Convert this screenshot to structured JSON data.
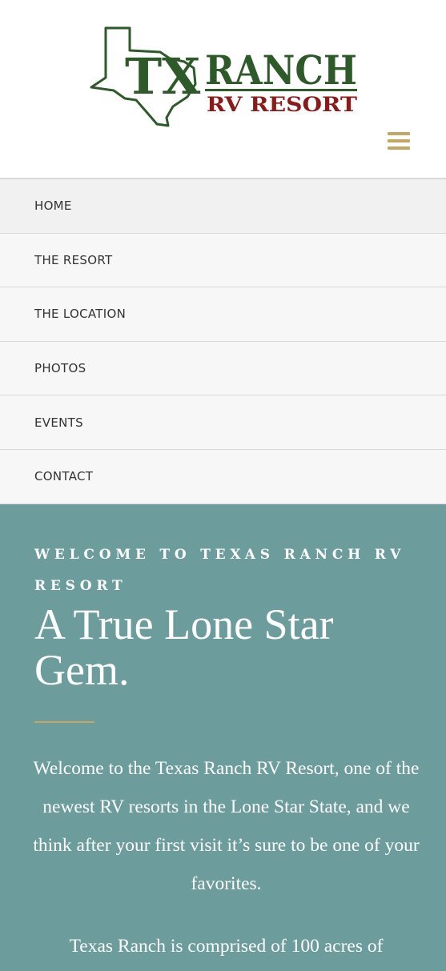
{
  "logo": {
    "mark": "TX",
    "name": "RANCH",
    "tagline": "RV RESORT",
    "colors": {
      "green": "#2e5a2a",
      "red": "#8b1a1a"
    }
  },
  "menu_icon": "hamburger-icon",
  "nav": {
    "items": [
      {
        "label": "HOME"
      },
      {
        "label": "THE RESORT"
      },
      {
        "label": "THE LOCATION"
      },
      {
        "label": "PHOTOS"
      },
      {
        "label": "EVENTS"
      },
      {
        "label": "CONTACT"
      }
    ]
  },
  "hero": {
    "eyebrow": "Welcome to Texas Ranch RV Resort",
    "headline": "A True Lone Star Gem.",
    "paragraph1": "Welcome to the Texas Ranch RV Resort, one of the newest RV resorts in the Lone Star State, and we think after your first visit it’s sure to be one of your favorites.",
    "paragraph2": "Texas Ranch is comprised of 100 acres of"
  },
  "colors": {
    "accent_gold": "#c7a564",
    "hero_teal": "#6c9c9c",
    "nav_bg": "#f7f7f7"
  }
}
